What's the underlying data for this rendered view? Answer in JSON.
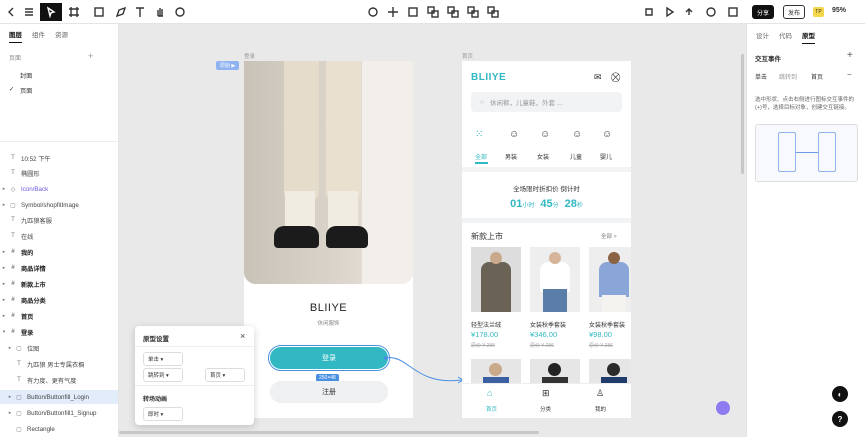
{
  "toolbar": {
    "share": "分享",
    "publish": "发布",
    "zoom": "95%",
    "badge": "TP"
  },
  "left": {
    "tabs": [
      "图层",
      "组件",
      "资源"
    ],
    "pages_title": "页面",
    "pages": [
      "封面",
      "页面"
    ],
    "layers": [
      "10:52 下午",
      "椭圆形",
      "Icon/Back",
      "Symbol/shopfitImage",
      "九匹狼客服",
      "在线",
      "我的",
      "商品详情",
      "新款上市",
      "商品分类",
      "首页",
      "登录",
      "位图",
      "九匹狼 男士专属衣橱",
      "有力度、更有气度",
      "Button/Buttonfill_Login",
      "Button/Buttonfill1_Signup",
      "Rectangle"
    ]
  },
  "right": {
    "tabs": [
      "设计",
      "代码",
      "原型"
    ],
    "section": "交互事件",
    "ev": [
      "单击",
      "跳转到",
      "首页"
    ],
    "desc": "选中形状、点击右侧进行图标交互事件的(+)号，选择目标对象，创建交互链接。"
  },
  "login": {
    "frame": "登录",
    "tag": "原始",
    "brand": "BLIIYE",
    "slogan": "休闲服饰",
    "login": "登录",
    "signup": "注册",
    "size": "250×48"
  },
  "home": {
    "frame": "首页",
    "brand": "BLIIYE",
    "search": "休闲裤，儿童鞋，外套 …",
    "cats": [
      "全部",
      "男装",
      "女装",
      "儿童",
      "婴儿"
    ],
    "flash": "全场限时折扣价 倒计时",
    "t1": "01",
    "u1": "小时",
    "t2": "45",
    "u2": "分",
    "t3": "28",
    "u3": "秒",
    "newt": "新款上市",
    "all": "全部 >",
    "products": [
      {
        "name": "轻型法兰绒",
        "price": "¥178.00",
        "old": "原价 ¥ 286"
      },
      {
        "name": "女装秋季套装",
        "price": "¥346.00",
        "old": "原价 ¥ 286"
      },
      {
        "name": "女装秋季套装",
        "price": "¥98.00",
        "old": "原价 ¥ 286"
      }
    ],
    "nav": [
      "首页",
      "分类",
      "我的"
    ]
  },
  "popup": {
    "title": "原型设置",
    "a": "单击",
    "b": "跳转到",
    "c": "首页",
    "anim": "转场动画",
    "d": "即时"
  },
  "colors": {
    "accent": "#31b8c2"
  }
}
